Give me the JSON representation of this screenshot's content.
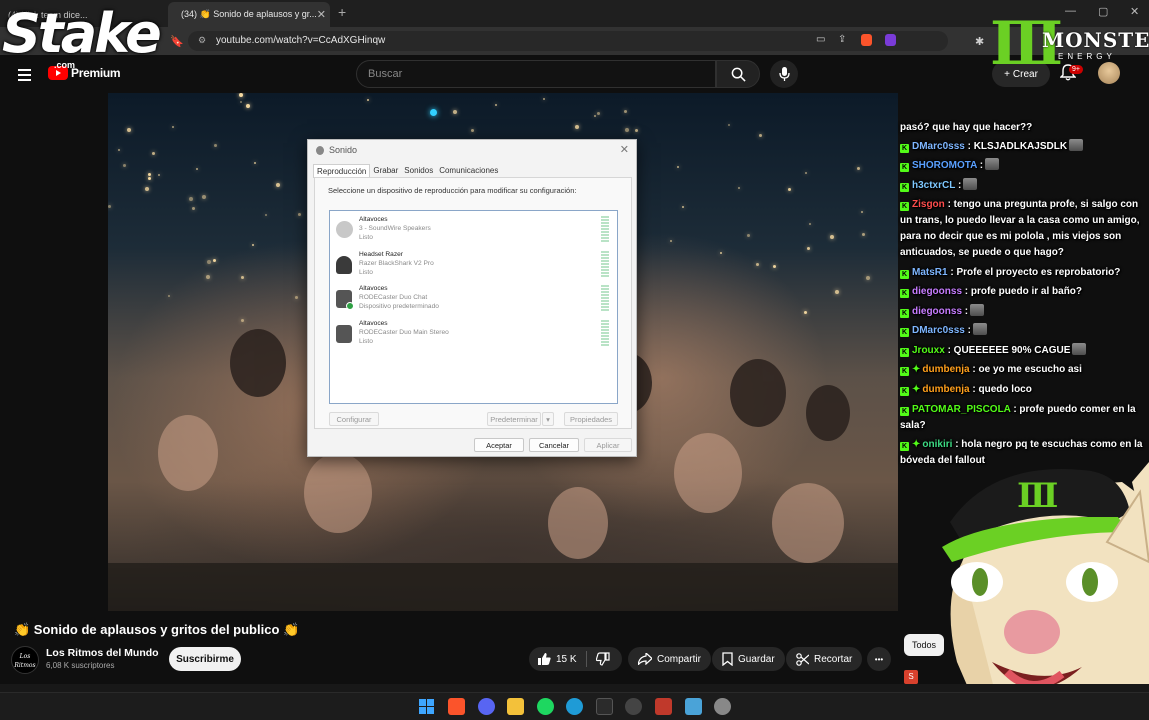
{
  "browser": {
    "tabs": [
      {
        "label": "(4) Kick team dice..."
      },
      {
        "label": "(34) 👏 Sonido de aplausos y gr..."
      }
    ],
    "new_tab": "+",
    "url": "youtube.com/watch?v=CcAdXGHinqw",
    "window_controls": [
      "—",
      "▢",
      "✕"
    ]
  },
  "youtube": {
    "logo_label": "Premium",
    "search_placeholder": "Buscar",
    "create_label": "Crear",
    "notif_badge": "9+"
  },
  "overlays": {
    "stake_logo": "Stake",
    "stake_sub": ".com",
    "monster_text": "MONSTER",
    "monster_sub": "ENERGY"
  },
  "dialog": {
    "title": "Sonido",
    "tabs": [
      "Reproducción",
      "Grabar",
      "Sonidos",
      "Comunicaciones"
    ],
    "instruction": "Seleccione un dispositivo de reproducción para modificar su configuración:",
    "devices": [
      {
        "name": "Altavoces",
        "desc": "3 - SoundWire Speakers",
        "status": "Listo",
        "icon": "speaker-icon"
      },
      {
        "name": "Headset Razer",
        "desc": "Razer BlackShark V2 Pro",
        "status": "Listo",
        "icon": "headset-icon"
      },
      {
        "name": "Altavoces",
        "desc": "RODECaster Duo Chat",
        "status": "Dispositivo predeterminado",
        "icon": "speaker-box-icon",
        "default": true
      },
      {
        "name": "Altavoces",
        "desc": "RODECaster Duo Main Stereo",
        "status": "Listo",
        "icon": "speaker-box-icon"
      }
    ],
    "buttons": {
      "configure": "Configurar",
      "set_default": "Predeterminar",
      "properties": "Propiedades",
      "ok": "Aceptar",
      "cancel": "Cancelar",
      "apply": "Aplicar"
    }
  },
  "chat": [
    {
      "user": "",
      "text": "pasó? que hay que hacer??",
      "color": "#ffffff",
      "badge": false
    },
    {
      "user": "DMarc0sss",
      "text": ": KLSJADLKAJSDLK",
      "color": "#7eb6ff",
      "badge": true,
      "emote": true
    },
    {
      "user": "SHOROMOTA",
      "text": ":",
      "color": "#5aa0ff",
      "badge": true,
      "emote": true
    },
    {
      "user": "h3ctxrCL",
      "text": ":",
      "color": "#7ec8ff",
      "badge": true,
      "emote": true
    },
    {
      "user": "Zisgon",
      "text": ": tengo una pregunta profe, si salgo con un trans, lo puedo llevar a la casa como un amigo, para no decir que es mi polola , mis viejos son anticuados, se puede o que hago?",
      "color": "#ff4d4d",
      "badge": true
    },
    {
      "user": "MatsR1",
      "text": ": Profe el proyecto es reprobatorio?",
      "color": "#7eb6ff",
      "badge": true
    },
    {
      "user": "diegoonss",
      "text": ": profe puedo ir al baño?",
      "color": "#c77dff",
      "badge": true
    },
    {
      "user": "diegoonss",
      "text": ":",
      "color": "#c77dff",
      "badge": true,
      "emote": true
    },
    {
      "user": "DMarc0sss",
      "text": ":",
      "color": "#7eb6ff",
      "badge": true,
      "emote": true
    },
    {
      "user": "Jrouxx",
      "text": ": QUEEEEEE 90% CAGUE",
      "color": "#53fc18",
      "badge": true,
      "emote": true
    },
    {
      "user": "dumbenja",
      "text": ": oe yo me escucho asi",
      "color": "#ff9f1c",
      "badge": true,
      "spark": true
    },
    {
      "user": "dumbenja",
      "text": ": quedo loco",
      "color": "#ff9f1c",
      "badge": true,
      "spark": true
    },
    {
      "user": "PATOMAR_PISCOLA",
      "text": ": profe puedo comer en la sala?",
      "color": "#53fc18",
      "badge": true
    },
    {
      "user": "onikiri",
      "text": ": hola negro pq te escuchas como en la bóveda del fallout",
      "color": "#3ddc84",
      "badge": true,
      "spark": true
    }
  ],
  "video": {
    "title": "👏 Sonido de aplausos y gritos del publico 👏",
    "channel": "Los Ritmos del Mundo",
    "channel_avatar_text": "Los Ritmos",
    "subscribers": "6,08 K suscriptores",
    "subscribe_label": "Suscribirme",
    "likes": "15 K",
    "share_label": "Compartir",
    "save_label": "Guardar",
    "clip_label": "Recortar",
    "more_label": "•••",
    "filter_all": "Todos"
  },
  "colors": {
    "yt_red": "#ff0000",
    "kick_green": "#53fc18",
    "monster_green": "#6bd024"
  }
}
